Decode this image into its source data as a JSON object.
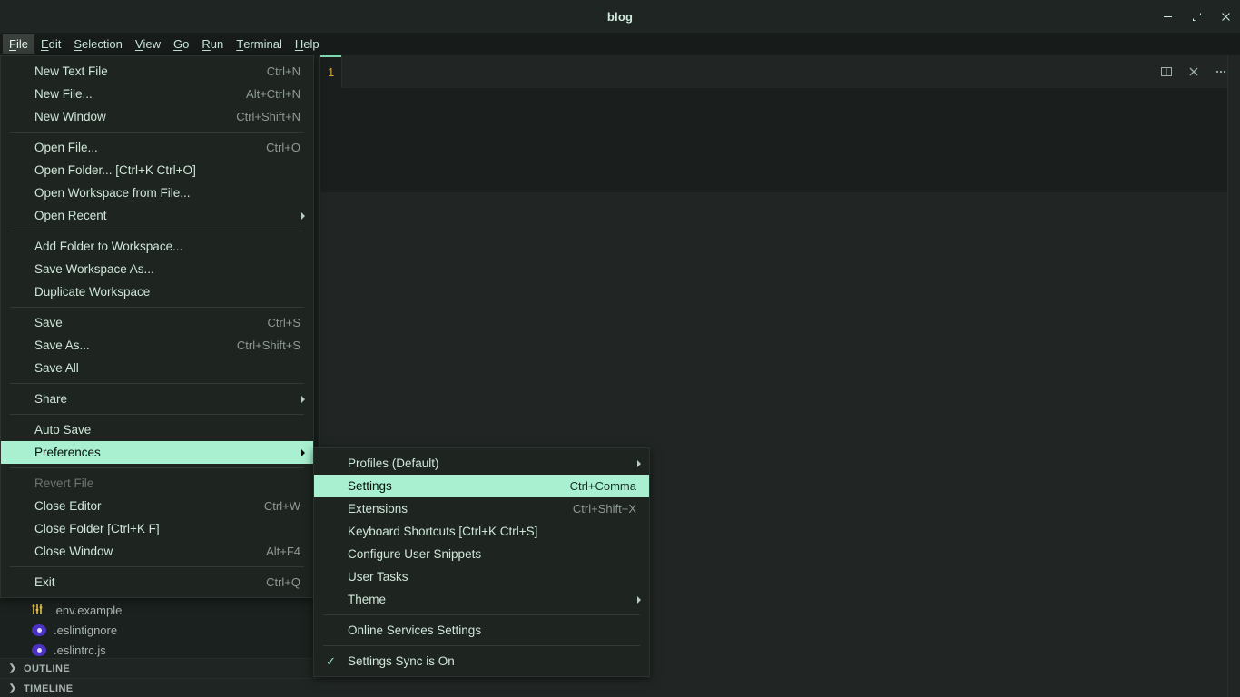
{
  "window": {
    "title": "blog",
    "controls": [
      {
        "name": "minimize",
        "glyph": "–"
      },
      {
        "name": "restore",
        "glyph": "⌐"
      },
      {
        "name": "close",
        "glyph": "✕"
      }
    ]
  },
  "menubar": {
    "items": [
      {
        "label": "File",
        "accel": "F",
        "active": true
      },
      {
        "label": "Edit",
        "accel": "E",
        "active": false
      },
      {
        "label": "Selection",
        "accel": "S",
        "active": false
      },
      {
        "label": "View",
        "accel": "V",
        "active": false
      },
      {
        "label": "Go",
        "accel": "G",
        "active": false
      },
      {
        "label": "Run",
        "accel": "R",
        "active": false
      },
      {
        "label": "Terminal",
        "accel": "T",
        "active": false
      },
      {
        "label": "Help",
        "accel": "H",
        "active": false
      }
    ]
  },
  "file_menu": {
    "items": [
      {
        "type": "item",
        "label": "New Text File",
        "keys": "Ctrl+N"
      },
      {
        "type": "item",
        "label": "New File...",
        "keys": "Alt+Ctrl+N"
      },
      {
        "type": "item",
        "label": "New Window",
        "keys": "Ctrl+Shift+N"
      },
      {
        "type": "sep"
      },
      {
        "type": "item",
        "label": "Open File...",
        "keys": "Ctrl+O"
      },
      {
        "type": "item",
        "label": "Open Folder... [Ctrl+K Ctrl+O]",
        "keys": ""
      },
      {
        "type": "item",
        "label": "Open Workspace from File...",
        "keys": ""
      },
      {
        "type": "item",
        "label": "Open Recent",
        "keys": "",
        "submenu": true
      },
      {
        "type": "sep"
      },
      {
        "type": "item",
        "label": "Add Folder to Workspace...",
        "keys": ""
      },
      {
        "type": "item",
        "label": "Save Workspace As...",
        "keys": ""
      },
      {
        "type": "item",
        "label": "Duplicate Workspace",
        "keys": ""
      },
      {
        "type": "sep"
      },
      {
        "type": "item",
        "label": "Save",
        "keys": "Ctrl+S"
      },
      {
        "type": "item",
        "label": "Save As...",
        "keys": "Ctrl+Shift+S"
      },
      {
        "type": "item",
        "label": "Save All",
        "keys": ""
      },
      {
        "type": "sep"
      },
      {
        "type": "item",
        "label": "Share",
        "keys": "",
        "submenu": true
      },
      {
        "type": "sep"
      },
      {
        "type": "item",
        "label": "Auto Save",
        "keys": ""
      },
      {
        "type": "item",
        "label": "Preferences",
        "keys": "",
        "submenu": true,
        "selected": true
      },
      {
        "type": "sep"
      },
      {
        "type": "item",
        "label": "Revert File",
        "keys": "",
        "disabled": true
      },
      {
        "type": "item",
        "label": "Close Editor",
        "keys": "Ctrl+W"
      },
      {
        "type": "item",
        "label": "Close Folder [Ctrl+K F]",
        "keys": ""
      },
      {
        "type": "item",
        "label": "Close Window",
        "keys": "Alt+F4"
      },
      {
        "type": "sep"
      },
      {
        "type": "item",
        "label": "Exit",
        "keys": "Ctrl+Q"
      }
    ]
  },
  "preferences_menu": {
    "items": [
      {
        "type": "item",
        "label": "Profiles (Default)",
        "keys": "",
        "submenu": true
      },
      {
        "type": "item",
        "label": "Settings",
        "keys": "Ctrl+Comma",
        "selected": true
      },
      {
        "type": "item",
        "label": "Extensions",
        "keys": "Ctrl+Shift+X"
      },
      {
        "type": "item",
        "label": "Keyboard Shortcuts [Ctrl+K Ctrl+S]",
        "keys": ""
      },
      {
        "type": "item",
        "label": "Configure User Snippets",
        "keys": ""
      },
      {
        "type": "item",
        "label": "User Tasks",
        "keys": ""
      },
      {
        "type": "item",
        "label": "Theme",
        "keys": "",
        "submenu": true
      },
      {
        "type": "sep"
      },
      {
        "type": "item",
        "label": "Online Services Settings",
        "keys": ""
      },
      {
        "type": "sep"
      },
      {
        "type": "item",
        "label": "Settings Sync is On",
        "keys": "",
        "checked": true
      }
    ]
  },
  "sidebar": {
    "files": [
      {
        "name": ".env.example",
        "icon": "settings-sliders-icon"
      },
      {
        "name": ".eslintignore",
        "icon": "eslint-dot-icon"
      },
      {
        "name": ".eslintrc.js",
        "icon": "eslint-dot-icon"
      }
    ],
    "panels": [
      {
        "label": "OUTLINE"
      },
      {
        "label": "TIMELINE"
      }
    ]
  },
  "editor": {
    "tab_label": "1",
    "actions": [
      {
        "name": "split-editor-icon"
      },
      {
        "name": "close-icon"
      },
      {
        "name": "more-actions-icon"
      }
    ]
  },
  "colors": {
    "accent": "#a8f0cf",
    "titlebar_bg": "#1f2522",
    "menubar_bg": "#171c1a",
    "menu_bg": "#1e2420",
    "editor_bg": "#212624",
    "text": "#cfe6da"
  }
}
